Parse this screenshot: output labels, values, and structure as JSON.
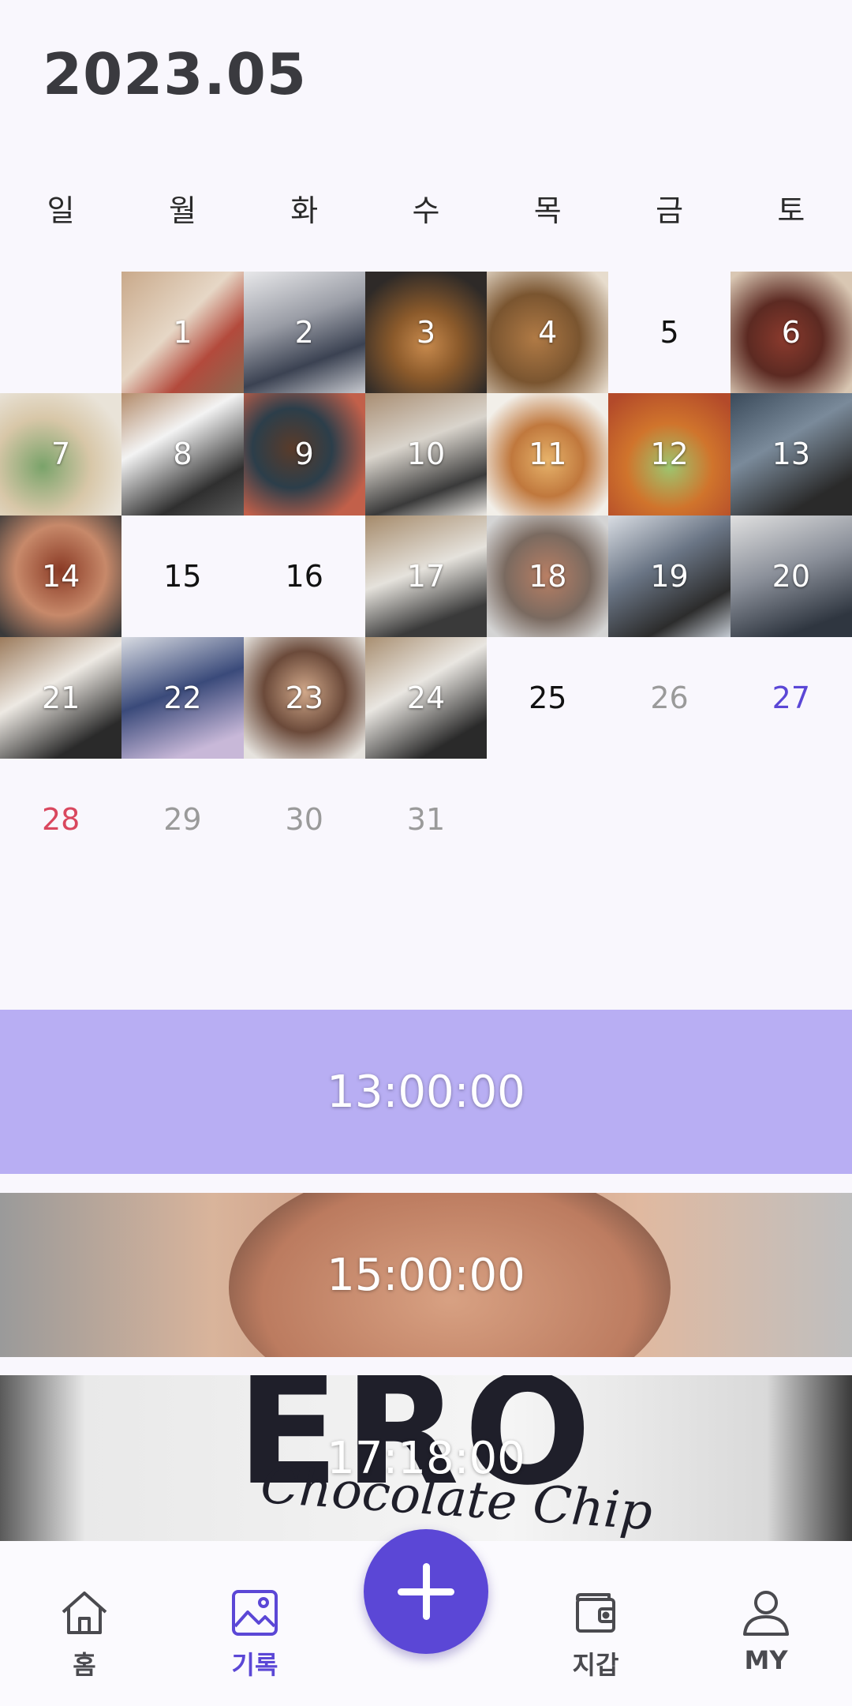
{
  "header": {
    "title": "2023.05"
  },
  "weekdays": [
    "일",
    "월",
    "화",
    "수",
    "목",
    "금",
    "토"
  ],
  "calendar": {
    "days": [
      {
        "n": "1"
      },
      {
        "n": "2"
      },
      {
        "n": "3"
      },
      {
        "n": "4"
      },
      {
        "n": "5"
      },
      {
        "n": "6"
      },
      {
        "n": "7"
      },
      {
        "n": "8"
      },
      {
        "n": "9"
      },
      {
        "n": "10"
      },
      {
        "n": "11"
      },
      {
        "n": "12"
      },
      {
        "n": "13"
      },
      {
        "n": "14"
      },
      {
        "n": "15"
      },
      {
        "n": "16"
      },
      {
        "n": "17"
      },
      {
        "n": "18"
      },
      {
        "n": "19"
      },
      {
        "n": "20"
      },
      {
        "n": "21"
      },
      {
        "n": "22"
      },
      {
        "n": "23"
      },
      {
        "n": "24"
      },
      {
        "n": "25"
      },
      {
        "n": "26"
      },
      {
        "n": "27"
      },
      {
        "n": "28"
      },
      {
        "n": "29"
      },
      {
        "n": "30"
      },
      {
        "n": "31"
      }
    ]
  },
  "timeline": [
    {
      "time": "13:00:00"
    },
    {
      "time": "15:00:00"
    },
    {
      "time": "17:18:00"
    }
  ],
  "timeline_decor": {
    "brand_text": "ERO",
    "sub_text": "Chocolate Chip"
  },
  "bottom_nav": {
    "home": {
      "label": "홈",
      "icon": "home-icon"
    },
    "record": {
      "label": "기록",
      "icon": "image-icon"
    },
    "add": {
      "icon": "plus-icon"
    },
    "wallet": {
      "label": "지갑",
      "icon": "wallet-icon"
    },
    "my": {
      "label": "MY",
      "icon": "user-icon"
    }
  },
  "colors": {
    "accent": "#5b47d6",
    "timeline_highlight": "#b8aef3",
    "sunday": "#d9475e",
    "saturday": "#5b47d6",
    "future_day": "#9a9a9a"
  }
}
